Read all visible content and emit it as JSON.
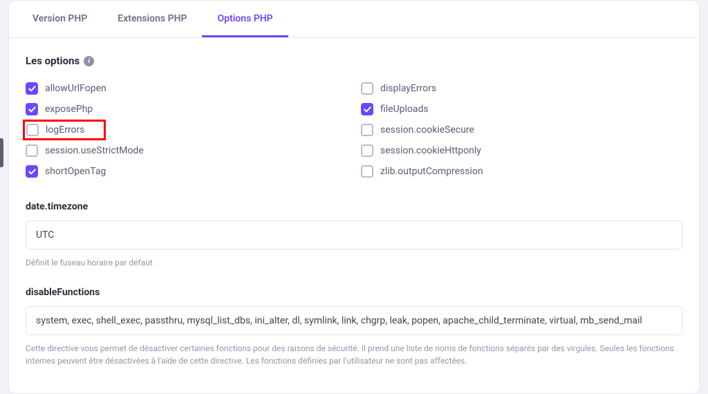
{
  "tabs": {
    "version": "Version PHP",
    "extensions": "Extensions PHP",
    "options": "Options PHP"
  },
  "sections": {
    "options_title": "Les options",
    "timezone_label": "date.timezone",
    "timezone_value": "UTC",
    "timezone_help": "Définit le fuseau horaire par défaut",
    "disable_label": "disableFunctions",
    "disable_value": "system, exec, shell_exec, passthru, mysql_list_dbs, ini_alter, dl, symlink, link, chgrp, leak, popen, apache_child_terminate, virtual, mb_send_mail",
    "disable_help": "Cette directive vous permet de désactiver certaines fonctions pour des raisons de sécurité. Il prend une liste de noms de fonctions séparés par des virgules. Seules les fonctions internes peuvent être désactivées à l'aide de cette directive. Les fonctions définies par l'utilisateur ne sont pas affectées."
  },
  "options_left": [
    {
      "label": "allowUrlFopen",
      "checked": true,
      "highlight": false
    },
    {
      "label": "exposePhp",
      "checked": true,
      "highlight": false
    },
    {
      "label": "logErrors",
      "checked": false,
      "highlight": true
    },
    {
      "label": "session.useStrictMode",
      "checked": false,
      "highlight": false
    },
    {
      "label": "shortOpenTag",
      "checked": true,
      "highlight": false
    }
  ],
  "options_right": [
    {
      "label": "displayErrors",
      "checked": false
    },
    {
      "label": "fileUploads",
      "checked": true
    },
    {
      "label": "session.cookieSecure",
      "checked": false
    },
    {
      "label": "session.cookieHttponly",
      "checked": false
    },
    {
      "label": "zlib.outputCompression",
      "checked": false
    }
  ]
}
